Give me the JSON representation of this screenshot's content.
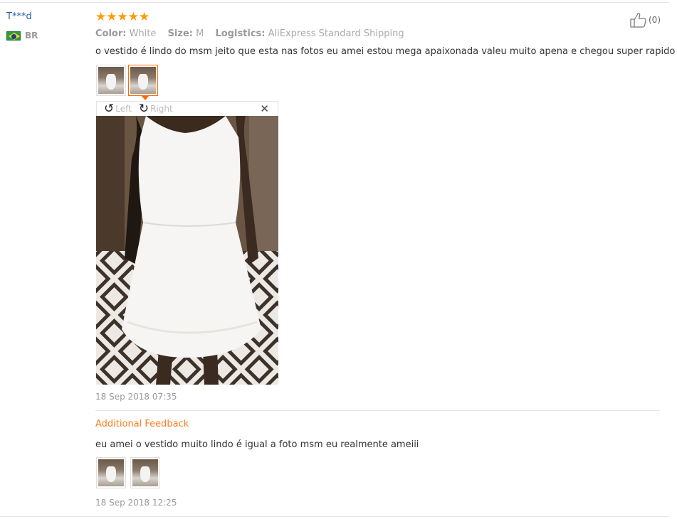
{
  "reviewer": {
    "name": "T***d",
    "country_code": "BR",
    "flag": "brazil-flag"
  },
  "rating": {
    "stars": 5,
    "max": 5,
    "color": "#ff9a00"
  },
  "helpful": {
    "count": "(0)",
    "icon": "thumbs-up-icon"
  },
  "meta": {
    "color_label": "Color:",
    "color_value": "White",
    "size_label": "Size:",
    "size_value": "M",
    "logistics_label": "Logistics:",
    "logistics_value": "AliExpress Standard Shipping"
  },
  "review_text": "o vestido é lindo do msm jeito que esta nas fotos eu amei estou mega apaixonada valeu muito apena e chegou super rapido",
  "photos": {
    "count": 2,
    "selected_index": 1
  },
  "viewer": {
    "rotate_left_label": "Left",
    "rotate_right_label": "Right",
    "close_icon": "close-icon"
  },
  "review_date": "18 Sep 2018 07:35",
  "additional_feedback": {
    "heading": "Additional Feedback",
    "text": "eu amei o vestido muito lindo é igual a foto msm eu realmente ameiii",
    "photo_count": 2,
    "date": "18 Sep 2018 12:25"
  },
  "colors": {
    "accent": "#ff6a00",
    "link": "#2161ad",
    "heading": "#ff7b1c"
  }
}
